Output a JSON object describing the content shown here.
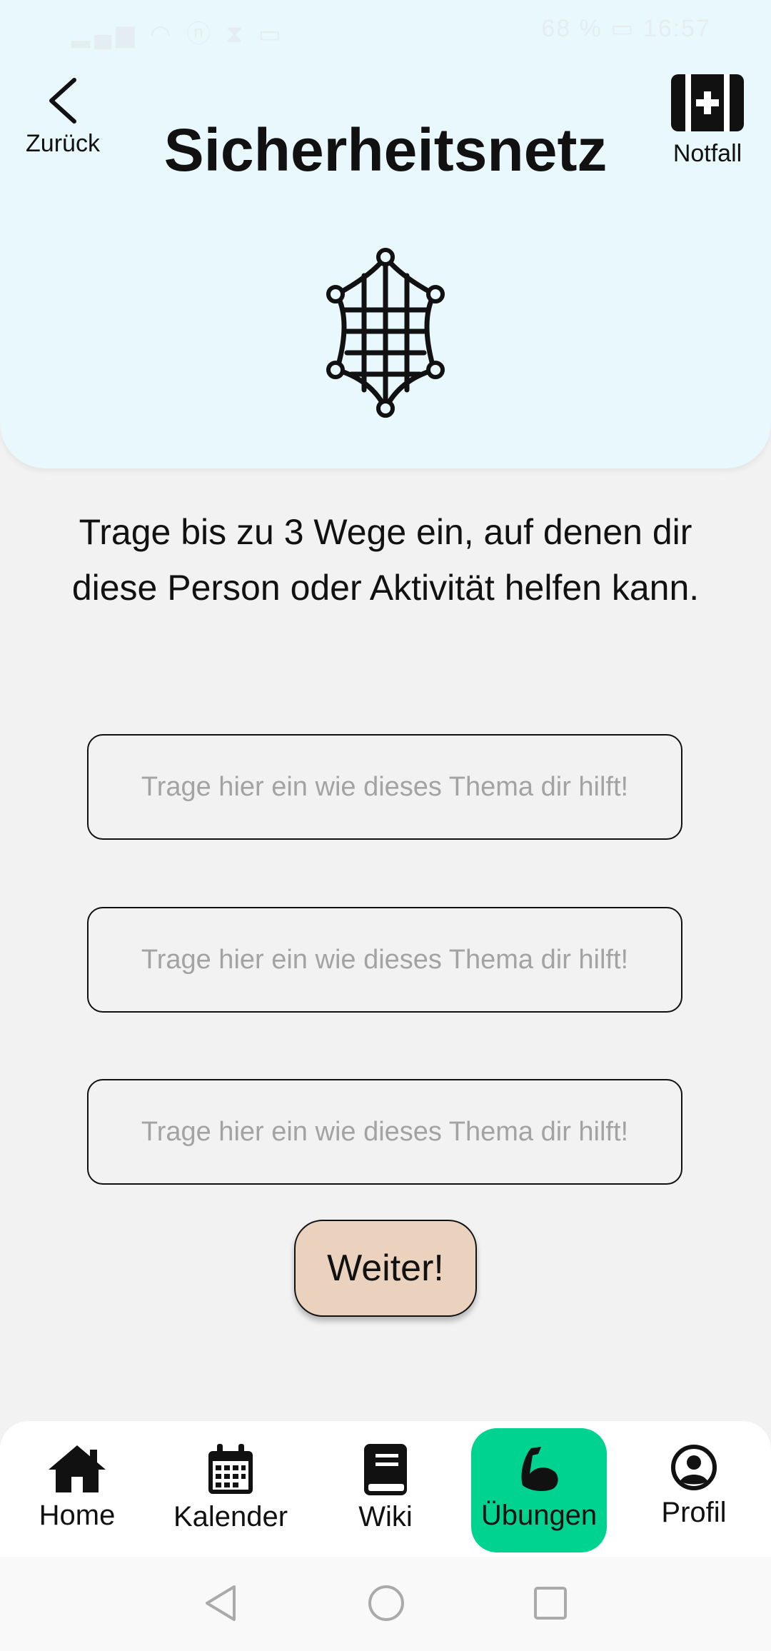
{
  "status_bar": {
    "left_icons": "signal wifi nfc hourglass sim",
    "battery": "68 %",
    "time": "16:57"
  },
  "header": {
    "back_label": "Zurück",
    "title": "Sicherheitsnetz",
    "emergency_label": "Notfall",
    "hero_icon": "safety-net-icon"
  },
  "main": {
    "instruction": "Trage bis zu 3 Wege ein, auf denen dir diese Person oder Aktivität helfen kann.",
    "fields": [
      {
        "value": "",
        "placeholder": "Trage hier ein wie dieses Thema dir hilft!"
      },
      {
        "value": "",
        "placeholder": "Trage hier ein wie dieses Thema dir hilft!"
      },
      {
        "value": "",
        "placeholder": "Trage hier ein wie dieses Thema dir hilft!"
      }
    ],
    "next_label": "Weiter!"
  },
  "nav": {
    "items": [
      {
        "label": "Home",
        "icon": "home-icon"
      },
      {
        "label": "Kalender",
        "icon": "calendar-icon"
      },
      {
        "label": "Wiki",
        "icon": "book-icon"
      },
      {
        "label": "Übungen",
        "icon": "muscle-icon",
        "active": true
      },
      {
        "label": "Profil",
        "icon": "profile-icon"
      }
    ],
    "active_color": "#00d38f"
  },
  "colors": {
    "header_bg": "#e9f8fd",
    "page_bg": "#f2f2f2",
    "button_bg": "#ebd2be"
  }
}
